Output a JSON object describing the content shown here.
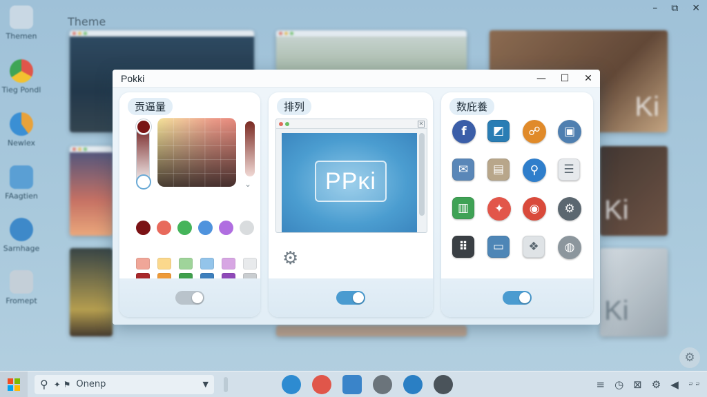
{
  "desktop": {
    "section_title": "Theme",
    "icons": [
      {
        "label": "Themen",
        "icon": "folder-icon",
        "color": "#c9d8e4"
      },
      {
        "label": "Tieg Pondl",
        "icon": "chrome-icon",
        "color": "#e0564a"
      },
      {
        "label": "Newlex",
        "icon": "browser-icon",
        "color": "#e8a23a"
      },
      {
        "label": "FAagtien",
        "icon": "monitor-icon",
        "color": "#5a9fd4"
      },
      {
        "label": "Sarnhage",
        "icon": "globe-icon",
        "color": "#3e89c9"
      },
      {
        "label": "Fromept",
        "icon": "folder-icon",
        "color": "#c4cfd8"
      }
    ],
    "window_controls": [
      "–",
      "⧉",
      "✕"
    ]
  },
  "window": {
    "title": "Pokki",
    "controls": {
      "minimize": "—",
      "maximize": "☐",
      "close": "✕"
    }
  },
  "panels": {
    "color": {
      "label": "贡逼量",
      "swatches": [
        "#7b1215",
        "#e86a5c",
        "#45b45a",
        "#4f93dd",
        "#b06ee0",
        "#d9dcde"
      ],
      "squares": [
        "#f0a698",
        "#fbd88c",
        "#9fd49a",
        "#93c4ea",
        "#d7a6e3",
        "#e8eaec",
        "#a8282a",
        "#ee9a38",
        "#3f9f4c",
        "#3d7fbd",
        "#8e49b8",
        "#c9cdd0",
        "#b8362e",
        "#e9c9a2",
        "#4aa55e",
        "#4a8fd0",
        "#a9b1b8",
        "#f2f3f4"
      ],
      "toggle_on": false
    },
    "layout": {
      "label": "排列",
      "preview_text": "PPĸi",
      "toggle_on": true
    },
    "apps": {
      "label": "数庇養",
      "icons": [
        {
          "name": "facebook-icon",
          "glyph": "f",
          "color": "#3b5ea8",
          "shape": "round"
        },
        {
          "name": "chart-app-icon",
          "glyph": "◩",
          "color": "#2a7db4",
          "shape": "square"
        },
        {
          "name": "network-icon",
          "glyph": "☍",
          "color": "#e08a2a",
          "shape": "round"
        },
        {
          "name": "chat-icon",
          "glyph": "▣",
          "color": "#4f7fb0",
          "shape": "round"
        },
        {
          "name": "mail-icon",
          "glyph": "✉",
          "color": "#5a87b8",
          "shape": "square"
        },
        {
          "name": "folder-icon",
          "glyph": "▤",
          "color": "#b8a68a",
          "shape": "square"
        },
        {
          "name": "map-pin-icon",
          "glyph": "⚲",
          "color": "#2f7ecb",
          "shape": "round"
        },
        {
          "name": "notes-icon",
          "glyph": "☰",
          "color": "#e6e9ec",
          "shape": "square"
        },
        {
          "name": "battery-icon",
          "glyph": "▥",
          "color": "#3fa255",
          "shape": "square"
        },
        {
          "name": "pinwheel-icon",
          "glyph": "✦",
          "color": "#e2564a",
          "shape": "round"
        },
        {
          "name": "chrome-icon",
          "glyph": "◉",
          "color": "#d94a3b",
          "shape": "round"
        },
        {
          "name": "settings-icon",
          "glyph": "⚙",
          "color": "#5b6770",
          "shape": "round"
        },
        {
          "name": "terminal-icon",
          "glyph": "⠿",
          "color": "#3a3f44",
          "shape": "square"
        },
        {
          "name": "card-icon",
          "glyph": "▭",
          "color": "#4e86b6",
          "shape": "square"
        },
        {
          "name": "photos-icon",
          "glyph": "❖",
          "color": "#dfe3e6",
          "shape": "square"
        },
        {
          "name": "github-icon",
          "glyph": "◍",
          "color": "#8c969d",
          "shape": "round"
        }
      ],
      "toggle_on": true
    }
  },
  "taskbar": {
    "search_text": "Onenp",
    "apps": [
      {
        "name": "edge-icon",
        "color": "#2d8bd1"
      },
      {
        "name": "chrome-icon",
        "color": "#e0564a"
      },
      {
        "name": "store-icon",
        "color": "#3a84c9"
      },
      {
        "name": "chat-icon",
        "color": "#6b747b"
      },
      {
        "name": "browser-icon",
        "color": "#2a7fc4"
      },
      {
        "name": "settings-icon",
        "color": "#4a535a"
      }
    ],
    "tray": [
      "≡",
      "◷",
      "⊠",
      "⚙",
      "◀"
    ],
    "clock": "ㄹ ㄹ"
  }
}
